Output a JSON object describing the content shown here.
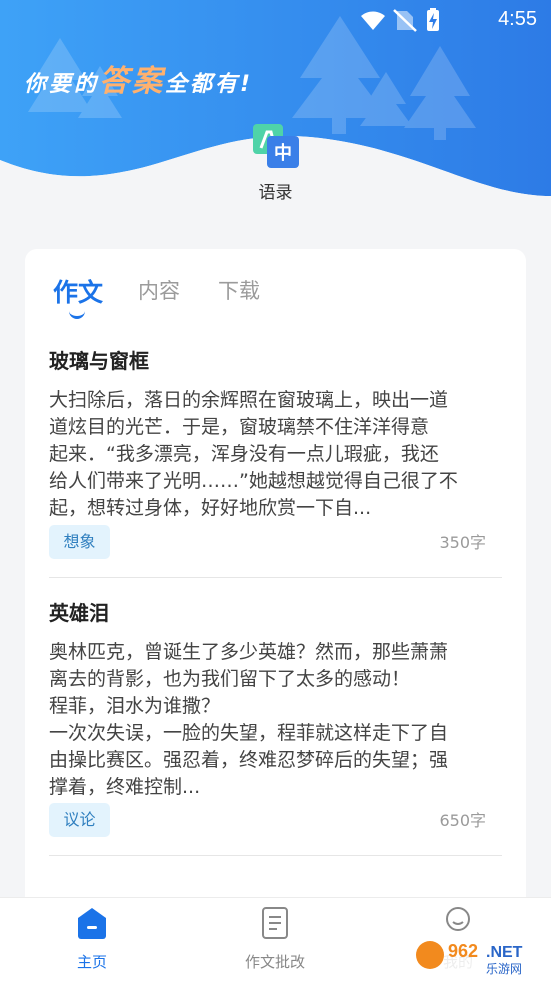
{
  "status_bar": {
    "time": "4:55",
    "icons": [
      "wifi-icon",
      "no-sim-icon",
      "battery-charging-icon"
    ]
  },
  "header": {
    "slogan_prefix": "你要的",
    "slogan_accent": "答案",
    "slogan_suffix": "全都有!",
    "app_icon": "translate-icon",
    "app_label": "语录",
    "colors": {
      "gradient_start": "#3a9cf5",
      "gradient_end": "#2f7de8",
      "accent": "#ffb16e"
    }
  },
  "tabs": [
    {
      "label": "作文",
      "active": true
    },
    {
      "label": "内容",
      "active": false
    },
    {
      "label": "下载",
      "active": false
    }
  ],
  "articles": [
    {
      "title": "玻璃与窗框",
      "body": "大扫除后，落日的余辉照在窗玻璃上，映出一道\n道炫目的光芒．于是，窗玻璃禁不住洋洋得意\n起来．“我多漂亮，浑身没有一点儿瑕疵，我还\n给人们带来了光明……”她越想越觉得自己很了不\n起，想转过身体，好好地欣赏一下自...",
      "tag": "想象",
      "count": "350字"
    },
    {
      "title": "英雄泪",
      "body": "奥林匹克，曾诞生了多少英雄？然而，那些萧萧\n离去的背影，也为我们留下了太多的感动！\n程菲，泪水为谁撒？\n一次次失误，一脸的失望，程菲就这样走下了自\n由操比赛区。强忍着，终难忍梦碎后的失望；强\n撑着，终难控制...",
      "tag": "议论",
      "count": "650字"
    }
  ],
  "bottom_nav": [
    {
      "label": "主页",
      "icon": "home-icon",
      "active": true
    },
    {
      "label": "作文批改",
      "icon": "document-icon",
      "active": false
    },
    {
      "label": "我的",
      "icon": "user-icon",
      "active": false
    }
  ],
  "watermark": {
    "logo_text": "962.NET",
    "sub_text": "乐游网"
  },
  "colors": {
    "primary": "#1b73e8",
    "tag_bg": "#e3f3fd",
    "tag_text": "#2f7fbf"
  }
}
